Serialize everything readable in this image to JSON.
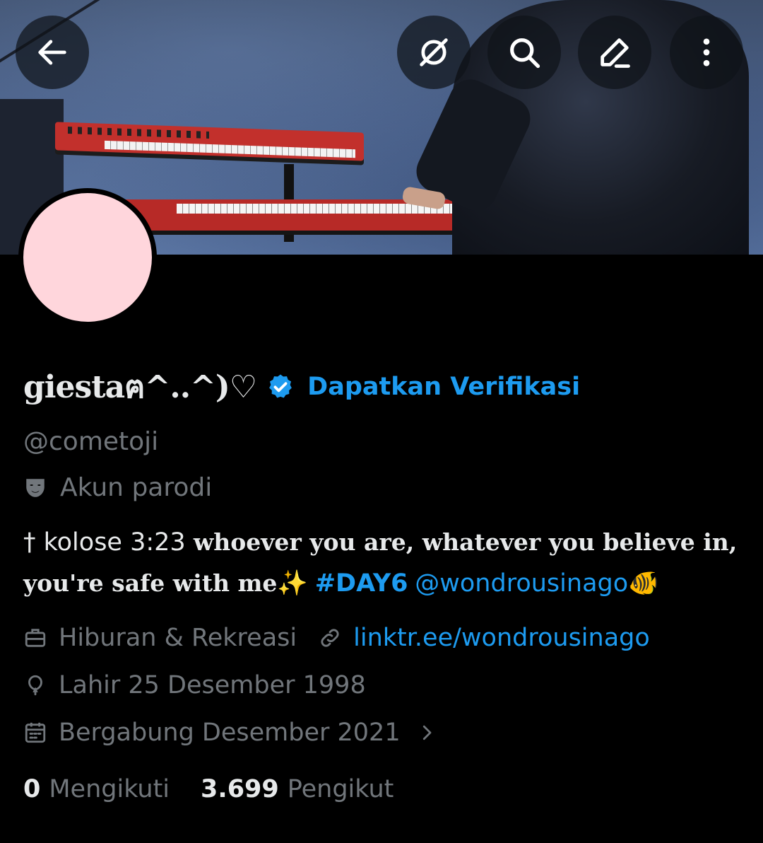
{
  "colors": {
    "accent": "#1d9bf0",
    "muted": "#71767b",
    "text": "#e7e9ea",
    "background": "#000000",
    "avatar_fill": "#ffd6dc"
  },
  "header": {
    "icons": [
      "back-arrow-icon",
      "grok-icon",
      "search-icon",
      "edit-icon",
      "more-vertical-icon"
    ]
  },
  "profile": {
    "display_name": "giestaฅ^..^)♡",
    "verified_link": "Dapatkan Verifikasi",
    "handle": "@cometoji",
    "parody_label": "Akun parodi",
    "bio": {
      "prefix": "† kolose 3:23 ",
      "styled": "whoever you are, whatever you believe in, you're safe with me",
      "sparkle": "✨",
      "hashtag": "#DAY6",
      "mention": "@wondrousinago",
      "fish": "🐠"
    },
    "category": "Hiburan & Rekreasi",
    "website": "linktr.ee/wondrousinago",
    "birthday": "Lahir 25 Desember 1998",
    "joined": "Bergabung Desember 2021"
  },
  "stats": {
    "following_count": "0",
    "following_label": "Mengikuti",
    "followers_count": "3.699",
    "followers_label": "Pengikut"
  }
}
